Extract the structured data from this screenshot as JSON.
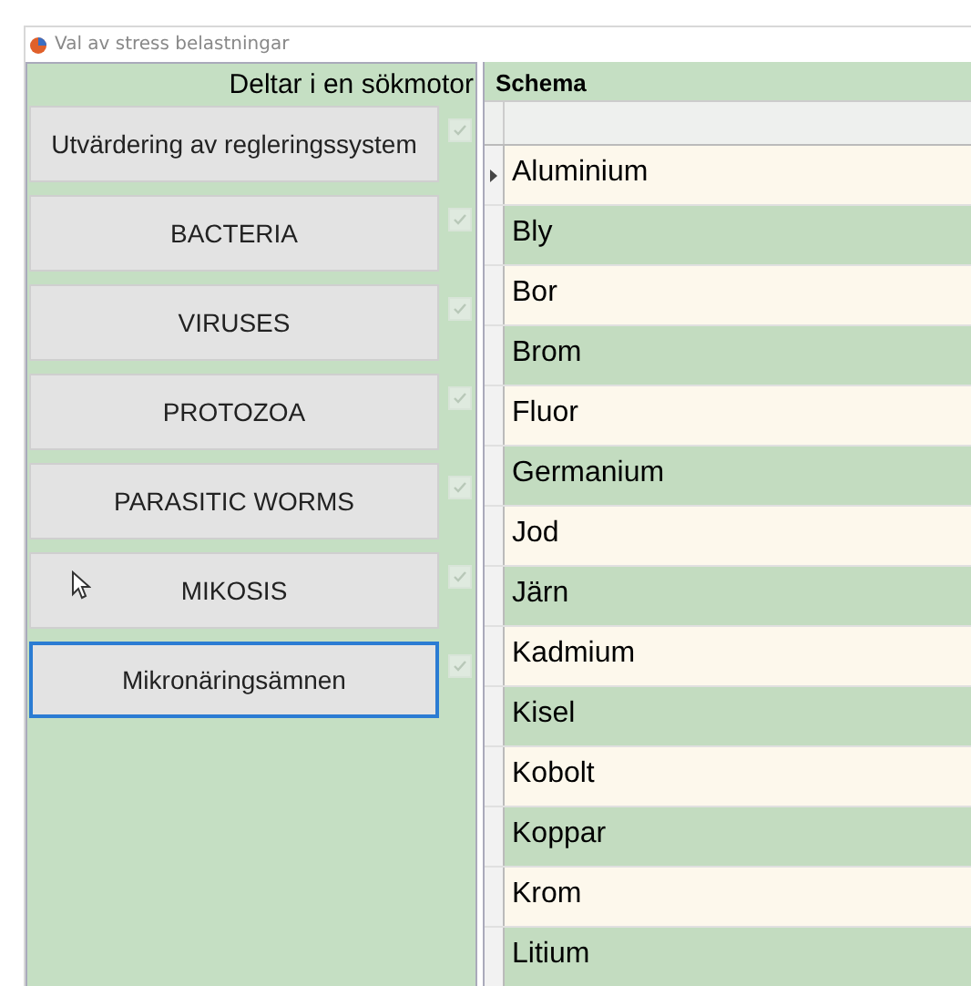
{
  "window": {
    "title": "Val av stress belastningar"
  },
  "left_panel": {
    "heading": "Deltar i en sökmotor",
    "buttons": [
      {
        "label": "Utvärdering av regleringssystem",
        "checked": true,
        "focused": false
      },
      {
        "label": "BACTERIA",
        "checked": true,
        "focused": false
      },
      {
        "label": "VIRUSES",
        "checked": true,
        "focused": false
      },
      {
        "label": "PROTOZOA",
        "checked": true,
        "focused": false
      },
      {
        "label": "PARASITIC WORMS",
        "checked": true,
        "focused": false
      },
      {
        "label": "MIKOSIS",
        "checked": true,
        "focused": false
      },
      {
        "label": "Mikronäringsämnen",
        "checked": true,
        "focused": true
      }
    ]
  },
  "grid": {
    "title": "Schema",
    "rows": [
      {
        "text": "Aluminium",
        "current": true
      },
      {
        "text": "Bly",
        "current": false
      },
      {
        "text": "Bor",
        "current": false
      },
      {
        "text": "Brom",
        "current": false
      },
      {
        "text": "Fluor",
        "current": false
      },
      {
        "text": "Germanium",
        "current": false
      },
      {
        "text": "Jod",
        "current": false
      },
      {
        "text": "Järn",
        "current": false
      },
      {
        "text": "Kadmium",
        "current": false
      },
      {
        "text": "Kisel",
        "current": false
      },
      {
        "text": "Kobolt",
        "current": false
      },
      {
        "text": "Koppar",
        "current": false
      },
      {
        "text": "Krom",
        "current": false
      },
      {
        "text": "Litium",
        "current": false
      }
    ]
  }
}
